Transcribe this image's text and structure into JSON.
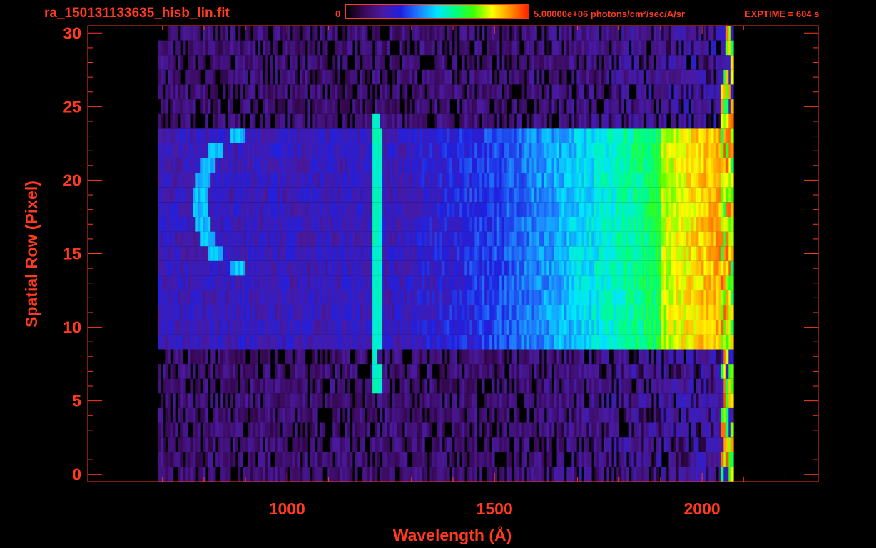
{
  "header": {
    "file_title": "ra_150131133635_hisb_lin.fit",
    "colorbar_min_label": "0",
    "colorbar_max_label": "5.00000e+06 photons/cm²/sec/A/sr",
    "exptime_label": "EXPTIME = 604 s"
  },
  "colors": {
    "axis": "#ff3a1e",
    "background": "#000000",
    "colormap": [
      "#000000",
      "#3a0a5a",
      "#4a1aa0",
      "#2020e0",
      "#1f7fff",
      "#00e5ff",
      "#00ff80",
      "#40ff00",
      "#ffff00",
      "#ff9000",
      "#ff2000"
    ]
  },
  "chart_data": {
    "type": "heatmap",
    "title": "ra_150131133635_hisb_lin.fit",
    "xlabel": "Wavelength (Å)",
    "ylabel": "Spatial Row (Pixel)",
    "xlim": [
      520,
      2280
    ],
    "ylim": [
      -0.5,
      30.5
    ],
    "x_ticks": [
      1000,
      1500,
      2000
    ],
    "y_ticks": [
      0,
      5,
      10,
      15,
      20,
      25,
      30
    ],
    "colorbar": {
      "min": 0,
      "max": 5000000,
      "units": "photons/cm²/sec/A/sr"
    },
    "grid": false,
    "description_of_structure": {
      "signal_x_range": [
        690,
        2070
      ],
      "bright_rows": [
        9,
        23
      ],
      "lyman_alpha_line_x": 1216,
      "lyman_alpha_rows": [
        6,
        24
      ],
      "inner_arc_x_range": [
        790,
        880
      ],
      "inner_arc_rows": [
        14,
        23
      ]
    }
  }
}
